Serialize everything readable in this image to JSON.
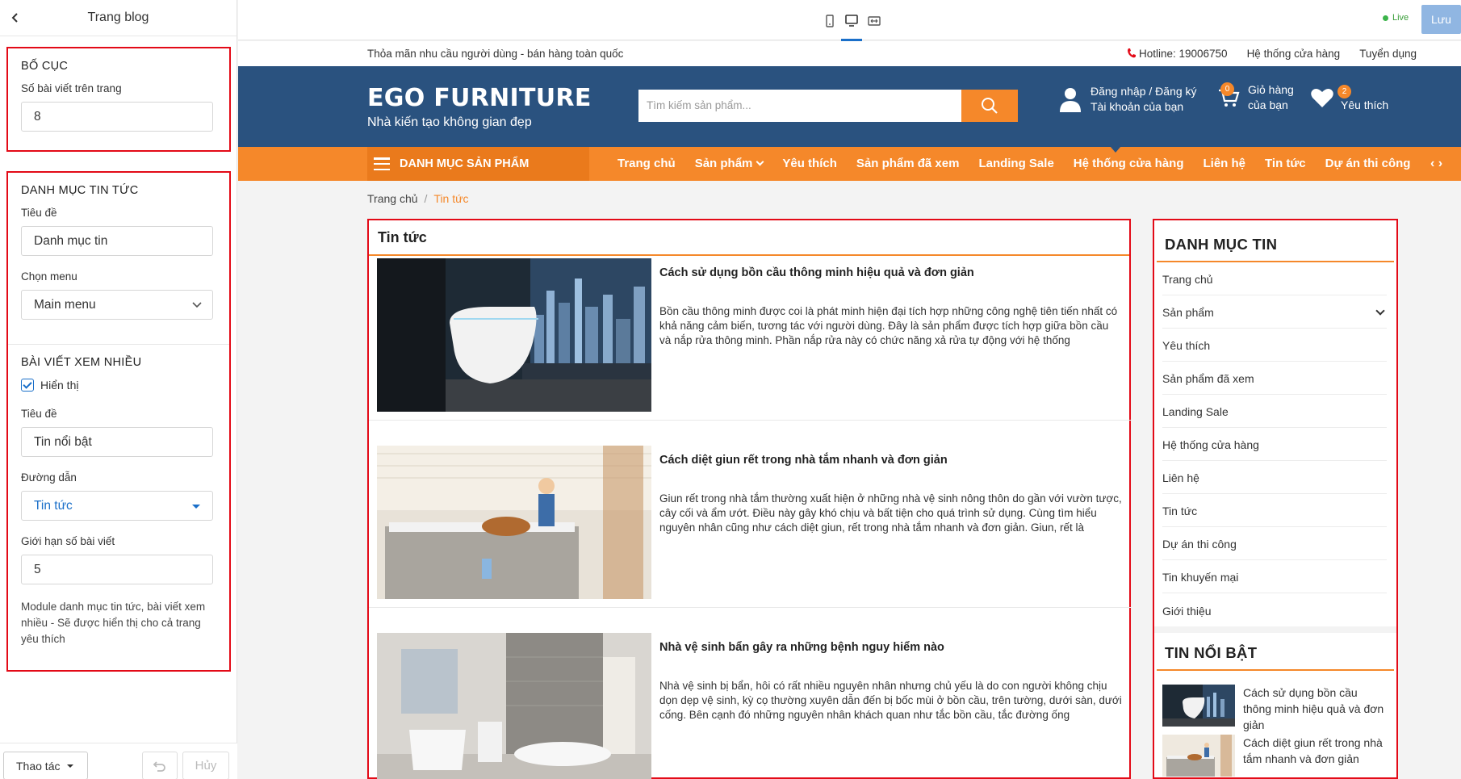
{
  "panel": {
    "title": "Trang blog",
    "layout": {
      "heading": "BỐ CỤC",
      "posts_label": "Số bài viết trên trang",
      "posts_value": "8"
    },
    "news_category": {
      "heading": "DANH MỤC TIN TỨC",
      "title_label": "Tiêu đề",
      "title_value": "Danh mục tin",
      "menu_label": "Chọn menu",
      "menu_value": "Main menu"
    },
    "popular": {
      "heading": "BÀI VIẾT XEM NHIỀU",
      "show_label": "Hiển thị",
      "title_label": "Tiêu đề",
      "title_value": "Tin nổi bật",
      "path_label": "Đường dẫn",
      "path_value": "Tin tức",
      "limit_label": "Giới hạn số bài viết",
      "limit_value": "5",
      "note": "Module danh mục tin tức, bài viết xem nhiều - Sẽ được hiển thị cho cả trang yêu thích"
    },
    "footer": {
      "actions": "Thao tác",
      "cancel": "Hủy"
    }
  },
  "toolbar": {
    "live": "Live",
    "save": "Lưu"
  },
  "site": {
    "slogan": "Thỏa mãn nhu cầu người dùng - bán hàng toàn quốc",
    "hotline": "Hotline: 19006750",
    "stores": "Hệ thống cửa hàng",
    "jobs": "Tuyển dụng",
    "logo": "EGO FURNITURE",
    "tagline": "Nhà kiến tạo không gian đẹp",
    "search_placeholder": "Tìm kiếm sản phẩm...",
    "account_line1": "Đăng nhập / Đăng ký",
    "account_line2": "Tài khoản của bạn",
    "cart_count": "0",
    "cart_line1": "Giỏ hàng",
    "cart_line2": "của bạn",
    "fav_count": "2",
    "fav_label": "Yêu thích",
    "category_menu": "DANH MỤC SẢN PHẨM",
    "nav": [
      "Trang chủ",
      "Sản phẩm",
      "Yêu thích",
      "Sản phẩm đã xem",
      "Landing Sale",
      "Hệ thống cửa hàng",
      "Liên hệ",
      "Tin tức",
      "Dự án thi công"
    ],
    "nav_arrows": "‹ ›",
    "breadcrumb": {
      "home": "Trang chủ",
      "sep": "/",
      "current": "Tin tức"
    }
  },
  "news": {
    "heading": "Tin tức",
    "articles": [
      {
        "title": "Cách sử dụng bồn cầu thông minh hiệu quả và đơn giản",
        "desc": "Bồn cầu thông minh được coi là phát minh hiện đại tích hợp những công nghệ tiên tiến nhất có khả năng cảm biến, tương tác với người dùng. Đây là sản phẩm được tích hợp giữa bồn cầu và nắp rửa thông minh. Phần nắp rửa này có chức năng xả rửa tự động với hệ thống"
      },
      {
        "title": "Cách diệt giun rết trong nhà tắm nhanh và đơn giản",
        "desc": "Giun rết trong nhà tắm thường xuất hiện ở những nhà vệ sinh nông thôn do gần với vườn tược, cây cối và ẩm ướt. Điều này gây khó chịu và bất tiện cho quá trình sử dụng. Cùng tìm hiểu nguyên nhân cũng như cách diệt giun, rết trong nhà tắm nhanh và đơn giản. Giun, rết là"
      },
      {
        "title": "Nhà vệ sinh bẩn gây ra những bệnh nguy hiểm nào",
        "desc": "Nhà vệ sinh bị bẩn, hôi có rất nhiều nguyên nhân nhưng chủ yếu là do con người không chịu dọn dẹp vệ sinh, kỳ cọ thường xuyên dẫn đến bị bốc mùi ở bồn cầu, trên tường, dưới sàn, dưới cống. Bên cạnh đó những nguyên nhân khách quan như tắc bồn cầu, tắc đường ống"
      }
    ]
  },
  "sidebar": {
    "heading": "DANH MỤC TIN",
    "items": [
      "Trang chủ",
      "Sản phẩm",
      "Yêu thích",
      "Sản phẩm đã xem",
      "Landing Sale",
      "Hệ thống cửa hàng",
      "Liên hệ",
      "Tin tức",
      "Dự án thi công",
      "Tin khuyến mại",
      "Giới thiệu"
    ],
    "featured_heading": "TIN NỔI BẬT",
    "featured": [
      "Cách sử dụng bồn cầu thông minh hiệu quả và đơn giản",
      "Cách diệt giun rết trong nhà tắm nhanh và đơn giản"
    ]
  },
  "colors": {
    "brand_blue": "#2a527f",
    "accent_orange": "#f5882a",
    "highlight_red": "#e30a17",
    "link_blue": "#1a6fc9"
  }
}
